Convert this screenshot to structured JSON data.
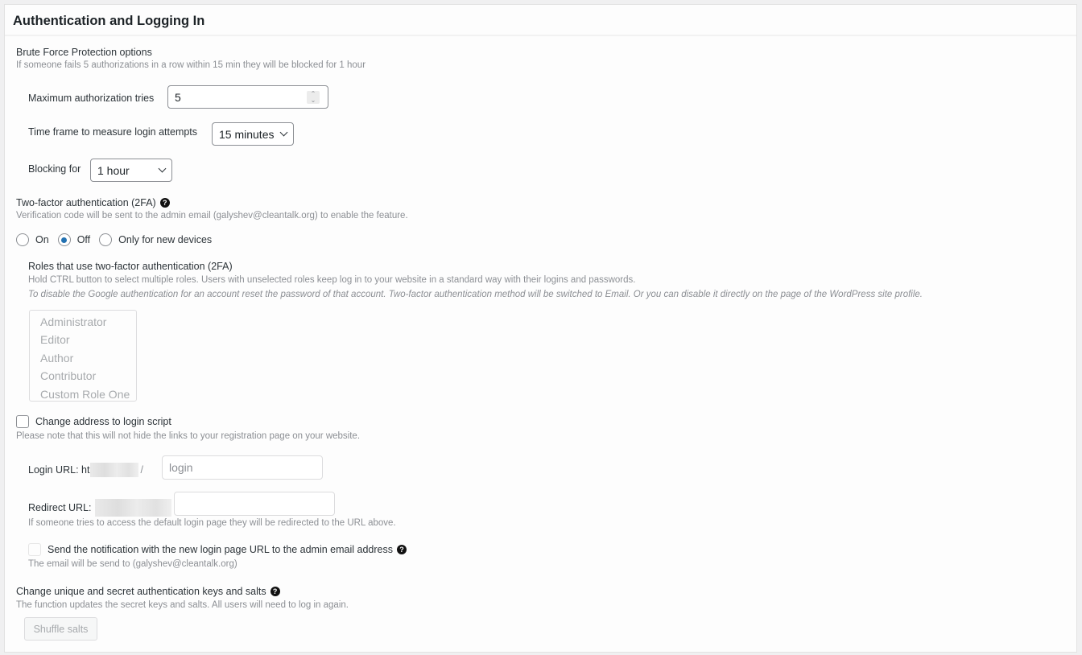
{
  "panel": {
    "title": "Authentication and Logging In"
  },
  "brute_force": {
    "heading": "Brute Force Protection options",
    "description": "If someone fails 5 authorizations in a row within 15 min they will be blocked for 1 hour",
    "max_tries_label": "Maximum authorization tries",
    "max_tries_value": "5",
    "time_frame_label": "Time frame to measure login attempts",
    "time_frame_value": "15 minutes",
    "blocking_label": "Blocking for",
    "blocking_value": "1 hour"
  },
  "two_factor": {
    "heading": "Two-factor authentication (2FA)",
    "help_icon": "question-circle-icon",
    "description": "Verification code will be sent to the admin email (galyshev@cleantalk.org) to enable the feature.",
    "options": [
      {
        "label": "On",
        "checked": false
      },
      {
        "label": "Off",
        "checked": true
      },
      {
        "label": "Only for new devices",
        "checked": false
      }
    ],
    "roles_heading": "Roles that use two-factor authentication (2FA)",
    "roles_description": "Hold CTRL button to select multiple roles. Users with unselected roles keep log in to your website in a standard way with their logins and passwords.",
    "roles_note": "To disable the Google authentication for an account reset the password of that account. Two-factor authentication method will be switched to Email. Or you can disable it directly on the page of the WordPress site profile.",
    "roles": [
      "Administrator",
      "Editor",
      "Author",
      "Contributor",
      "Custom Role One"
    ]
  },
  "login_address": {
    "checkbox_label": "Change address to login script",
    "checked": false,
    "description": "Please note that this will not hide the links to your registration page on your website.",
    "login_url_label": "Login URL: ht",
    "login_url_suffix": "/",
    "login_url_value": "login",
    "redirect_url_label": "Redirect URL:",
    "redirect_url_value": "",
    "redirect_description": "If someone tries to access the default login page they will be redirected to the URL above.",
    "notify_label": "Send the notification with the new login page URL to the admin email address",
    "notify_checked": false,
    "notify_description": "The email will be send to (galyshev@cleantalk.org)"
  },
  "salts": {
    "heading": "Change unique and secret authentication keys and salts",
    "description": "The function updates the secret keys and salts. All users will need to log in again.",
    "button_label": "Shuffle salts"
  },
  "colors": {
    "accent": "#2271b1",
    "muted_text": "#8c8f94",
    "page_bg": "#f0f0f1"
  }
}
